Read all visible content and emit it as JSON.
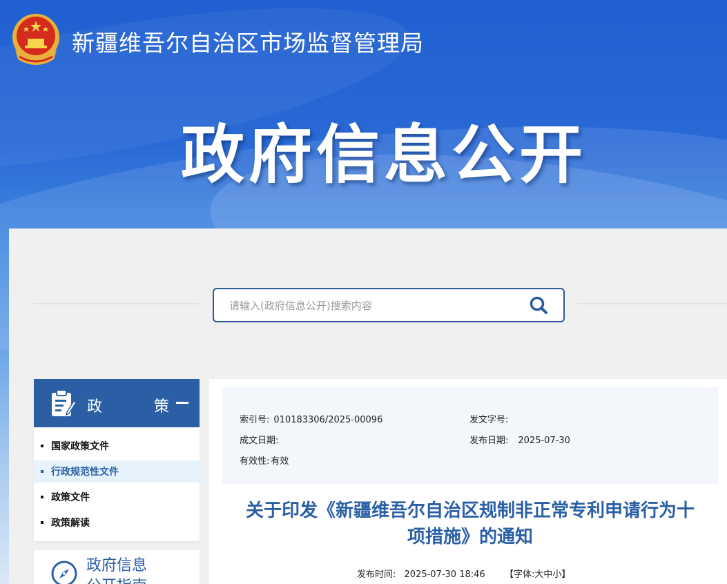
{
  "header": {
    "org_name": "新疆维吾尔自治区市场监督管理局",
    "hero_title": "政府信息公开"
  },
  "search": {
    "placeholder": "请输入(政府信息公开)搜索内容",
    "icon": "search-icon"
  },
  "sidebar": {
    "section_title": "政 策",
    "section_icon": "document-edit-icon",
    "collapse_icon": "minus-icon",
    "items": [
      {
        "label": "国家政策文件"
      },
      {
        "label": "行政规范性文件",
        "active": true
      },
      {
        "label": "政策文件"
      },
      {
        "label": "政策解读"
      }
    ],
    "second_card": {
      "icon": "compass-icon",
      "label": "政府信息",
      "label_cont": "公开指南"
    }
  },
  "meta": {
    "index_label": "索引号:",
    "index_value": "010183306/2025-00096",
    "docno_label": "发文字号:",
    "docno_value": "",
    "created_label": "成文日期:",
    "created_value": "",
    "publish_label": "发布日期:",
    "publish_value": "2025-07-30",
    "validity_label": "有效性:",
    "validity_value": "有效"
  },
  "article": {
    "title_line1": "关于印发《新疆维吾尔自治区规制非正常专利申请行为十",
    "title_line2": "项措施》的通知",
    "pub_time_label": "发布时间:",
    "pub_time_value": "2025-07-30 18:46",
    "font_label": "【字体:",
    "font_sizes": "大中小",
    "font_close": "】"
  },
  "colors": {
    "brand_blue": "#2a5fa6",
    "banner_top": "#1f5fd0",
    "active_bg": "#e6f2fc"
  }
}
